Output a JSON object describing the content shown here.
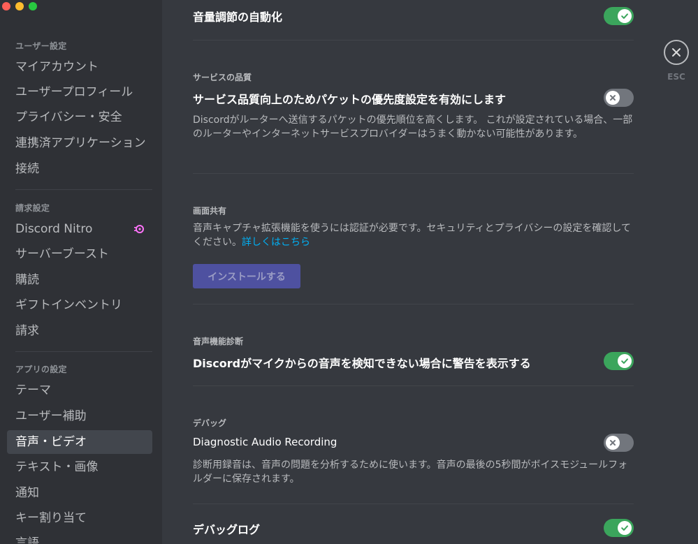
{
  "sidebar": {
    "user_settings_header": "ユーザー設定",
    "user_items": [
      {
        "label": "マイアカウント"
      },
      {
        "label": "ユーザープロフィール"
      },
      {
        "label": "プライバシー・安全"
      },
      {
        "label": "連携済アプリケーション"
      },
      {
        "label": "接続"
      }
    ],
    "billing_header": "請求設定",
    "billing_items": [
      {
        "label": "Discord Nitro",
        "icon": "nitro-icon"
      },
      {
        "label": "サーバーブースト"
      },
      {
        "label": "購読"
      },
      {
        "label": "ギフトインベントリ"
      },
      {
        "label": "請求"
      }
    ],
    "app_settings_header": "アプリの設定",
    "app_items": [
      {
        "label": "テーマ"
      },
      {
        "label": "ユーザー補助"
      },
      {
        "label": "音声・ビデオ",
        "active": true
      },
      {
        "label": "テキスト・画像"
      },
      {
        "label": "通知"
      },
      {
        "label": "キー割り当て"
      },
      {
        "label": "言語"
      }
    ]
  },
  "settings": {
    "auto_volume": {
      "title": "音量調節の自動化",
      "enabled": true
    },
    "qos": {
      "header": "サービスの品質",
      "title": "サービス品質向上のためパケットの優先度設定を有効にします",
      "enabled": false,
      "description": "Discordがルーターへ送信するパケットの優先順位を高くします。 これが設定されている場合、一部のルーターやインターネットサービスプロバイダーはうまく動かない可能性があります。"
    },
    "screen_share": {
      "header": "画面共有",
      "description": "音声キャプチャ拡張機能を使うには認証が必要です。セキュリティとプライバシーの設定を確認してください。",
      "link": "詳しくはこちら",
      "install_label": "インストールする"
    },
    "voice_diagnostics": {
      "header": "音声機能診断",
      "title": "Discordがマイクからの音声を検知できない場合に警告を表示する",
      "enabled": true
    },
    "debug": {
      "header": "デバッグ",
      "diag_title": "Diagnostic Audio Recording",
      "diag_enabled": false,
      "diag_description": "診断用録音は、音声の問題を分析するために使います。音声の最後の5秒間がボイスモジュールフォルダーに保存されます。",
      "log_title": "デバッグログ",
      "log_enabled": true
    }
  },
  "close": {
    "label": "ESC",
    "icon": "close-icon"
  },
  "colors": {
    "toggle_on": "#3ba55c",
    "toggle_off": "#72767d",
    "link": "#00b0f4",
    "button": "#4e51a0"
  }
}
